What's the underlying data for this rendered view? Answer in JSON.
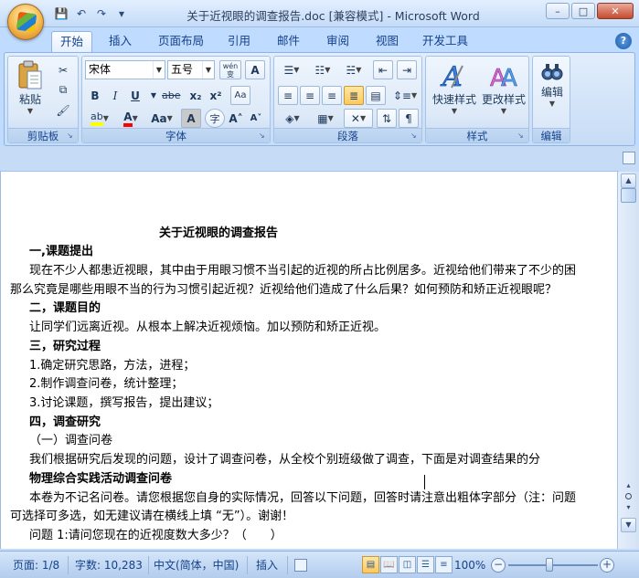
{
  "window": {
    "title": "关于近视眼的调查报告.doc [兼容模式] - Microsoft Word",
    "controls": {
      "minimize": "–",
      "maximize": "□",
      "close": "✕"
    }
  },
  "qat": {
    "save": "💾",
    "undo": "↶",
    "redo": "↷",
    "more": "▾"
  },
  "tabs": [
    "开始",
    "插入",
    "页面布局",
    "引用",
    "邮件",
    "审阅",
    "视图",
    "开发工具"
  ],
  "help": "?",
  "ribbon": {
    "clipboard": {
      "label": "剪贴板",
      "paste": "粘贴"
    },
    "font": {
      "label": "字体",
      "font_name": "宋体",
      "font_size": "五号",
      "wen_button": "wén\n变",
      "btn_A": "A",
      "bold": "B",
      "italic": "I",
      "underline": "U",
      "strike": "abe",
      "sub": "x₂",
      "sup": "x²",
      "clear": "Aa",
      "case": "Aa",
      "grow": "A˄",
      "shrink": "A˅"
    },
    "paragraph": {
      "label": "段落"
    },
    "styles": {
      "label": "样式",
      "quick": "快速样式",
      "change": "更改样式"
    },
    "editing": {
      "label": "编辑",
      "main": "编辑"
    }
  },
  "document": {
    "title": "关于近视眼的调查报告",
    "lines": [
      {
        "text": "一,课题提出",
        "bold": true
      },
      {
        "text": "现在不少人都患近视眼，其中由于用眼习惯不当引起的近视的所占比例居多。近视给他们带来了不少的困",
        "bold": false
      },
      {
        "text": "那么究竟是哪些用眼不当的行为习惯引起近视？近视给他们造成了什么后果？如何预防和矫正近视眼呢？",
        "bold": false
      },
      {
        "text": "二，课题目的",
        "bold": true
      },
      {
        "text": "让同学们远离近视。从根本上解决近视烦恼。加以预防和矫正近视。",
        "bold": false
      },
      {
        "text": "三，研究过程",
        "bold": true
      },
      {
        "text": "1.确定研究思路，方法，进程；",
        "bold": false
      },
      {
        "text": "2.制作调查问卷，统计整理；",
        "bold": false
      },
      {
        "text": "3.讨论课题，撰写报告，提出建议；",
        "bold": false
      },
      {
        "text": "四，调查研究",
        "bold": true
      },
      {
        "text": "（一）调查问卷",
        "bold": false
      },
      {
        "text": "我们根据研究后发现的问题，设计了调查问卷，从全校个别班级做了调查，下面是对调查结果的分",
        "bold": false
      },
      {
        "text": "物理综合实践活动调查问卷",
        "bold": true
      },
      {
        "text": "本卷为不记名问卷。请您根据您自身的实际情况，回答以下问题，回答时请注意出粗体字部分（注：问题",
        "bold": false
      },
      {
        "text": "可选择可多选，如无建议请在横线上填 “无”）。谢谢！",
        "bold": false
      },
      {
        "text": "问题 1:请问您现在的近视度数大多少？（　　）",
        "bold": false
      }
    ]
  },
  "status": {
    "page": "页面: 1/8",
    "words": "字数: 10,283",
    "language": "中文(简体，中国)",
    "mode": "插入",
    "zoom": "100%",
    "zoom_level_percent": 100
  },
  "colors": {
    "accent": "#15428b",
    "ribbon_bg": "#bfdbff",
    "highlight": "#ffff00",
    "font_color": "#ff0000"
  }
}
